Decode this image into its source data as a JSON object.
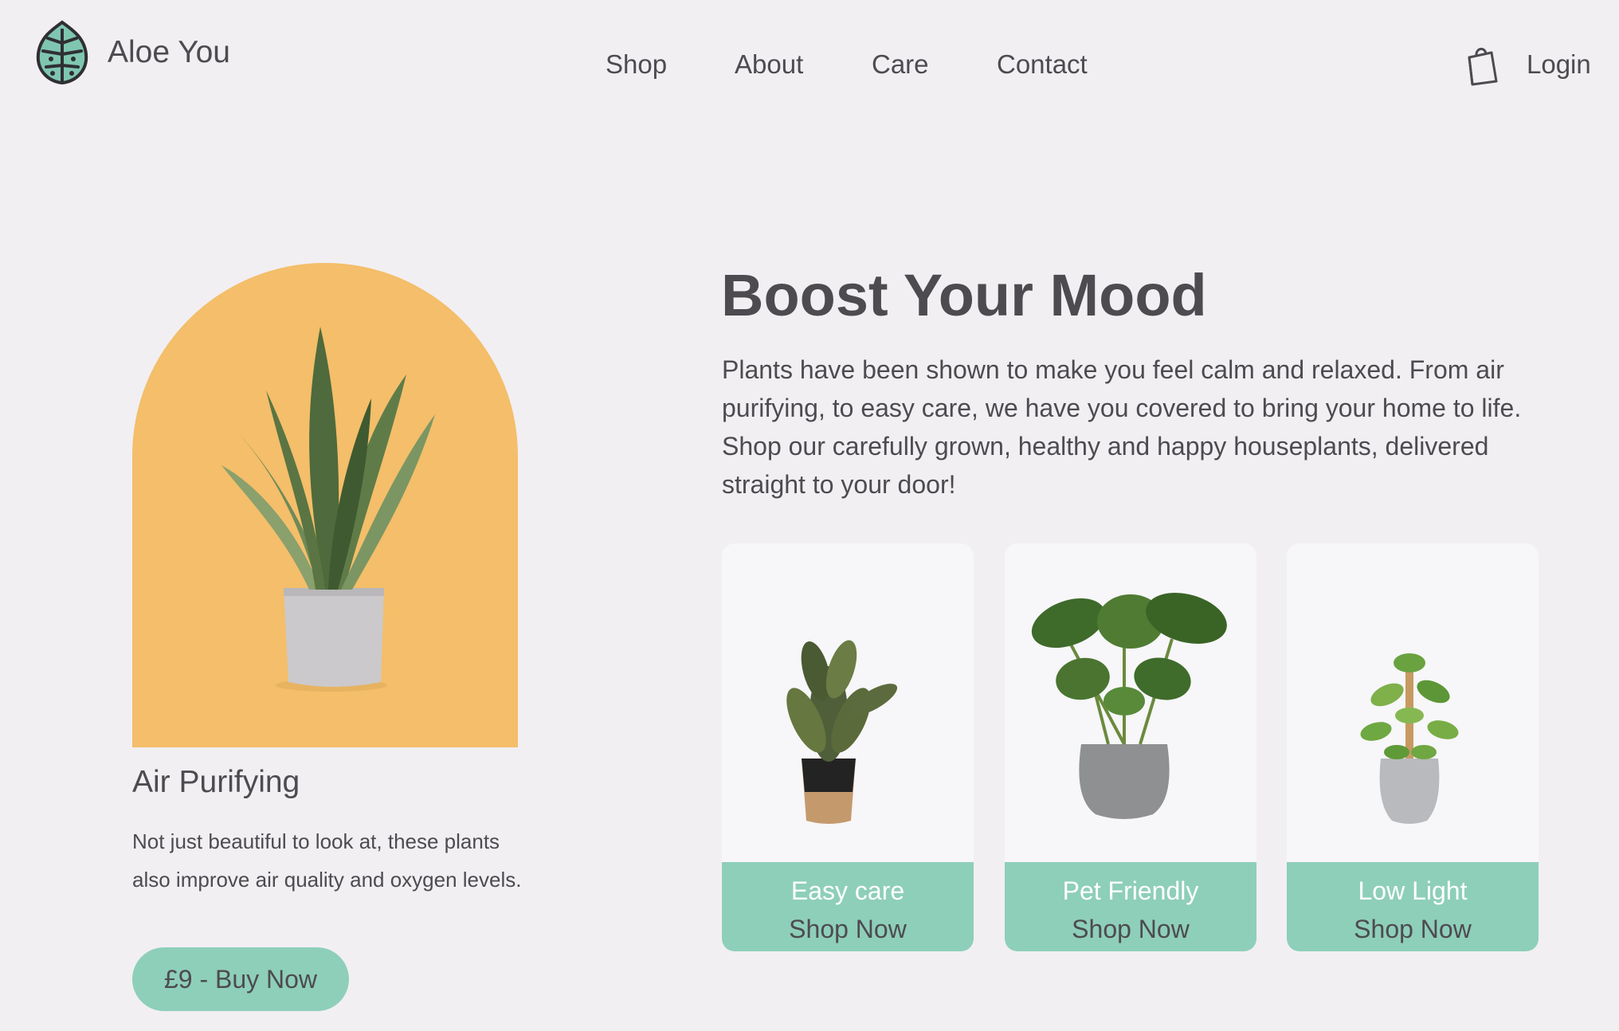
{
  "brand": {
    "name": "Aloe You",
    "logo_icon": "monstera-leaf-icon"
  },
  "nav": {
    "items": [
      {
        "label": "Shop"
      },
      {
        "label": "About"
      },
      {
        "label": "Care"
      },
      {
        "label": "Contact"
      }
    ]
  },
  "header": {
    "bag_icon": "shopping-bag-icon",
    "login_label": "Login"
  },
  "feature": {
    "title": "Air Purifying",
    "description": "Not just beautiful to look at, these plants also improve air quality and oxygen levels.",
    "button_label": "£9 - Buy Now",
    "image_icon": "snake-plant-image"
  },
  "hero": {
    "title": "Boost Your Mood",
    "body": "Plants have been shown to make you feel calm and relaxed. From air purifying, to easy care, we have you covered to bring your home to life. Shop our carefully grown, healthy and happy houseplants, delivered straight to your door!"
  },
  "cards": [
    {
      "category": "Easy care",
      "cta": "Shop Now",
      "image_icon": "rubber-plant-image"
    },
    {
      "category": "Pet Friendly",
      "cta": "Shop Now",
      "image_icon": "monstera-plant-image"
    },
    {
      "category": "Low Light",
      "cta": "Shop Now",
      "image_icon": "pothos-plant-image"
    }
  ],
  "colors": {
    "background": "#f1eff2",
    "accent": "#8ecfb9",
    "arch": "#f4be6a",
    "text": "#4d4b50"
  }
}
